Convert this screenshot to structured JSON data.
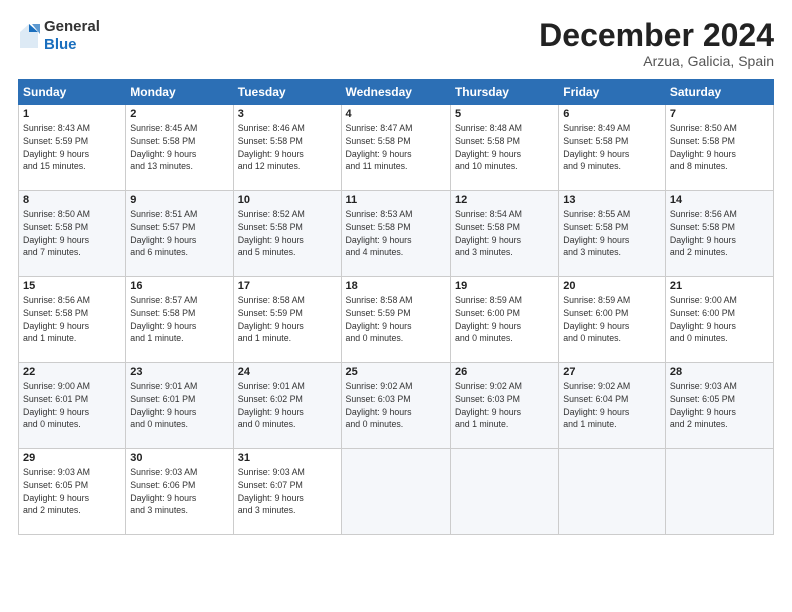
{
  "header": {
    "logo": {
      "general": "General",
      "blue": "Blue"
    },
    "title": "December 2024",
    "location": "Arzua, Galicia, Spain"
  },
  "weekdays": [
    "Sunday",
    "Monday",
    "Tuesday",
    "Wednesday",
    "Thursday",
    "Friday",
    "Saturday"
  ],
  "weeks": [
    [
      {
        "day": "1",
        "info": "Sunrise: 8:43 AM\nSunset: 5:59 PM\nDaylight: 9 hours\nand 15 minutes."
      },
      {
        "day": "2",
        "info": "Sunrise: 8:45 AM\nSunset: 5:58 PM\nDaylight: 9 hours\nand 13 minutes."
      },
      {
        "day": "3",
        "info": "Sunrise: 8:46 AM\nSunset: 5:58 PM\nDaylight: 9 hours\nand 12 minutes."
      },
      {
        "day": "4",
        "info": "Sunrise: 8:47 AM\nSunset: 5:58 PM\nDaylight: 9 hours\nand 11 minutes."
      },
      {
        "day": "5",
        "info": "Sunrise: 8:48 AM\nSunset: 5:58 PM\nDaylight: 9 hours\nand 10 minutes."
      },
      {
        "day": "6",
        "info": "Sunrise: 8:49 AM\nSunset: 5:58 PM\nDaylight: 9 hours\nand 9 minutes."
      },
      {
        "day": "7",
        "info": "Sunrise: 8:50 AM\nSunset: 5:58 PM\nDaylight: 9 hours\nand 8 minutes."
      }
    ],
    [
      {
        "day": "8",
        "info": "Sunrise: 8:50 AM\nSunset: 5:58 PM\nDaylight: 9 hours\nand 7 minutes."
      },
      {
        "day": "9",
        "info": "Sunrise: 8:51 AM\nSunset: 5:57 PM\nDaylight: 9 hours\nand 6 minutes."
      },
      {
        "day": "10",
        "info": "Sunrise: 8:52 AM\nSunset: 5:58 PM\nDaylight: 9 hours\nand 5 minutes."
      },
      {
        "day": "11",
        "info": "Sunrise: 8:53 AM\nSunset: 5:58 PM\nDaylight: 9 hours\nand 4 minutes."
      },
      {
        "day": "12",
        "info": "Sunrise: 8:54 AM\nSunset: 5:58 PM\nDaylight: 9 hours\nand 3 minutes."
      },
      {
        "day": "13",
        "info": "Sunrise: 8:55 AM\nSunset: 5:58 PM\nDaylight: 9 hours\nand 3 minutes."
      },
      {
        "day": "14",
        "info": "Sunrise: 8:56 AM\nSunset: 5:58 PM\nDaylight: 9 hours\nand 2 minutes."
      }
    ],
    [
      {
        "day": "15",
        "info": "Sunrise: 8:56 AM\nSunset: 5:58 PM\nDaylight: 9 hours\nand 1 minute."
      },
      {
        "day": "16",
        "info": "Sunrise: 8:57 AM\nSunset: 5:58 PM\nDaylight: 9 hours\nand 1 minute."
      },
      {
        "day": "17",
        "info": "Sunrise: 8:58 AM\nSunset: 5:59 PM\nDaylight: 9 hours\nand 1 minute."
      },
      {
        "day": "18",
        "info": "Sunrise: 8:58 AM\nSunset: 5:59 PM\nDaylight: 9 hours\nand 0 minutes."
      },
      {
        "day": "19",
        "info": "Sunrise: 8:59 AM\nSunset: 6:00 PM\nDaylight: 9 hours\nand 0 minutes."
      },
      {
        "day": "20",
        "info": "Sunrise: 8:59 AM\nSunset: 6:00 PM\nDaylight: 9 hours\nand 0 minutes."
      },
      {
        "day": "21",
        "info": "Sunrise: 9:00 AM\nSunset: 6:00 PM\nDaylight: 9 hours\nand 0 minutes."
      }
    ],
    [
      {
        "day": "22",
        "info": "Sunrise: 9:00 AM\nSunset: 6:01 PM\nDaylight: 9 hours\nand 0 minutes."
      },
      {
        "day": "23",
        "info": "Sunrise: 9:01 AM\nSunset: 6:01 PM\nDaylight: 9 hours\nand 0 minutes."
      },
      {
        "day": "24",
        "info": "Sunrise: 9:01 AM\nSunset: 6:02 PM\nDaylight: 9 hours\nand 0 minutes."
      },
      {
        "day": "25",
        "info": "Sunrise: 9:02 AM\nSunset: 6:03 PM\nDaylight: 9 hours\nand 0 minutes."
      },
      {
        "day": "26",
        "info": "Sunrise: 9:02 AM\nSunset: 6:03 PM\nDaylight: 9 hours\nand 1 minute."
      },
      {
        "day": "27",
        "info": "Sunrise: 9:02 AM\nSunset: 6:04 PM\nDaylight: 9 hours\nand 1 minute."
      },
      {
        "day": "28",
        "info": "Sunrise: 9:03 AM\nSunset: 6:05 PM\nDaylight: 9 hours\nand 2 minutes."
      }
    ],
    [
      {
        "day": "29",
        "info": "Sunrise: 9:03 AM\nSunset: 6:05 PM\nDaylight: 9 hours\nand 2 minutes."
      },
      {
        "day": "30",
        "info": "Sunrise: 9:03 AM\nSunset: 6:06 PM\nDaylight: 9 hours\nand 3 minutes."
      },
      {
        "day": "31",
        "info": "Sunrise: 9:03 AM\nSunset: 6:07 PM\nDaylight: 9 hours\nand 3 minutes."
      },
      {
        "day": "",
        "info": ""
      },
      {
        "day": "",
        "info": ""
      },
      {
        "day": "",
        "info": ""
      },
      {
        "day": "",
        "info": ""
      }
    ]
  ]
}
